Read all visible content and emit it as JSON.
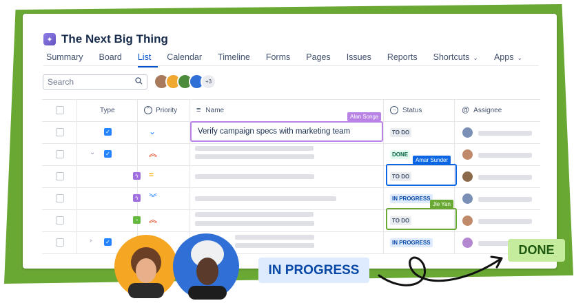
{
  "app": {
    "title": "The Next Big Thing"
  },
  "tabs": [
    {
      "label": "Summary",
      "active": false,
      "dropdown": false
    },
    {
      "label": "Board",
      "active": false,
      "dropdown": false
    },
    {
      "label": "List",
      "active": true,
      "dropdown": false
    },
    {
      "label": "Calendar",
      "active": false,
      "dropdown": false
    },
    {
      "label": "Timeline",
      "active": false,
      "dropdown": false
    },
    {
      "label": "Forms",
      "active": false,
      "dropdown": false
    },
    {
      "label": "Pages",
      "active": false,
      "dropdown": false
    },
    {
      "label": "Issues",
      "active": false,
      "dropdown": false
    },
    {
      "label": "Reports",
      "active": false,
      "dropdown": false
    },
    {
      "label": "Shortcuts",
      "active": false,
      "dropdown": true
    },
    {
      "label": "Apps",
      "active": false,
      "dropdown": true
    }
  ],
  "search": {
    "placeholder": "Search"
  },
  "avatars": {
    "more_label": "+3"
  },
  "columns": {
    "type": "Type",
    "priority": "Priority",
    "name": "Name",
    "status": "Status",
    "assignee": "Assignee"
  },
  "rows": [
    {
      "type": "task",
      "priority": "low",
      "name": "Verify campaign specs with marketing team",
      "status": "TO DO"
    },
    {
      "type": "task",
      "priority": "high",
      "name": "",
      "status": "DONE"
    },
    {
      "type": "subtask",
      "priority": "medium",
      "name": "",
      "status": "TO DO"
    },
    {
      "type": "subtask",
      "priority": "lowest",
      "name": "",
      "status": "IN PROGRESS"
    },
    {
      "type": "story",
      "priority": "high",
      "name": "",
      "status": "TO DO"
    },
    {
      "type": "task",
      "priority": "",
      "name": "",
      "status": "IN PROGRESS"
    }
  ],
  "collaborators": {
    "alan": "Alan Songa",
    "amar": "Amar Sunder",
    "jie": "Jie Yan"
  },
  "callouts": {
    "in_progress": "IN PROGRESS",
    "done": "DONE"
  },
  "colors": {
    "frame_green": "#6aa834",
    "accent_blue": "#0052cc",
    "alan_purple": "#b983e6",
    "amar_blue": "#0c66e4",
    "jie_green": "#6aa834"
  }
}
